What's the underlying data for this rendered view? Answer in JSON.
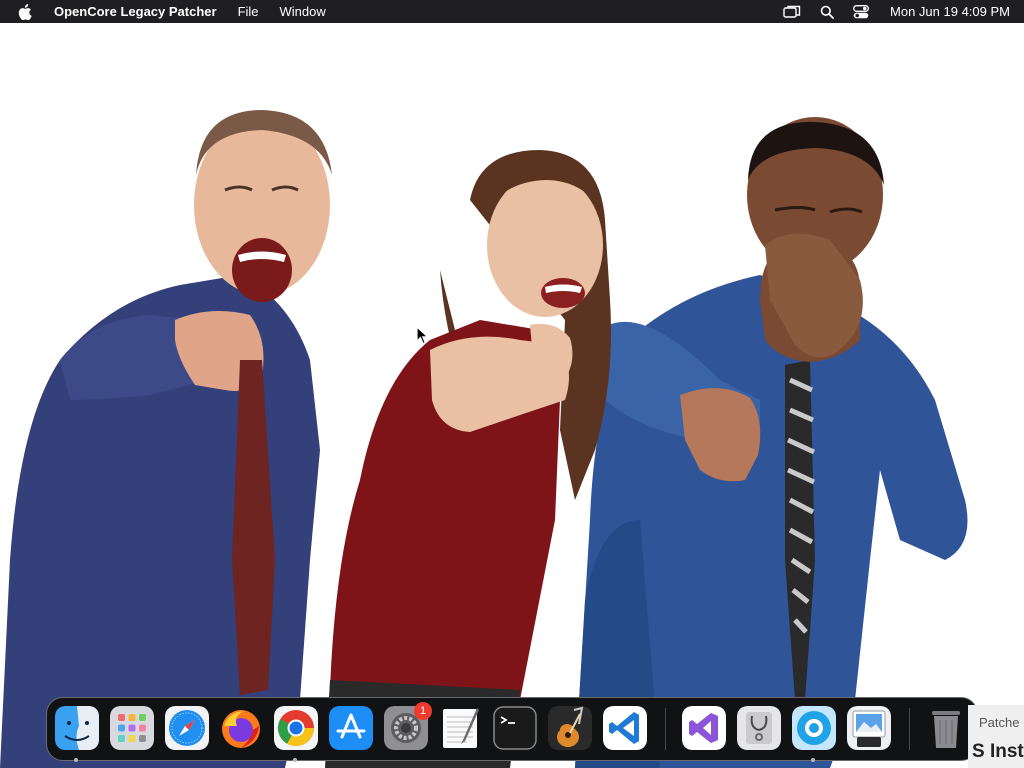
{
  "menubar": {
    "app_name": "OpenCore Legacy Patcher",
    "menus": [
      "File",
      "Window"
    ],
    "clock": "Mon Jun 19  4:09 PM",
    "background": "#1f1f21"
  },
  "wallpaper": {
    "description_icons": [
      "person-bald-man",
      "person-woman",
      "person-man-right"
    ],
    "colors": {
      "shirt_left": "#34407a",
      "dress_center": "#7e1418",
      "shirt_right": "#2f5497",
      "skin": "#e8b89a",
      "skin_dark": "#7a4a32"
    }
  },
  "dock": {
    "apps": [
      {
        "name": "Finder",
        "icon": "finder-icon",
        "running": true
      },
      {
        "name": "Launchpad",
        "icon": "launchpad-icon",
        "running": false
      },
      {
        "name": "Safari",
        "icon": "safari-icon",
        "running": false
      },
      {
        "name": "Firefox",
        "icon": "firefox-icon",
        "running": false
      },
      {
        "name": "Google Chrome",
        "icon": "chrome-icon",
        "running": true
      },
      {
        "name": "App Store",
        "icon": "app-store-icon",
        "running": false
      },
      {
        "name": "System Preferences",
        "icon": "system-preferences-icon",
        "running": false,
        "badge": "1"
      },
      {
        "name": "TextEdit",
        "icon": "textedit-icon",
        "running": false
      },
      {
        "name": "Terminal",
        "icon": "terminal-icon",
        "running": false
      },
      {
        "name": "GarageBand",
        "icon": "garageband-icon",
        "running": false
      },
      {
        "name": "Visual Studio Code",
        "icon": "vscode-icon",
        "running": false
      },
      {
        "name": "Visual Studio",
        "icon": "visual-studio-icon",
        "running": false
      },
      {
        "name": "System Information",
        "icon": "system-information-icon",
        "running": false
      },
      {
        "name": "OpenCore Legacy Patcher",
        "icon": "opencore-icon",
        "running": true
      },
      {
        "name": "Preview",
        "icon": "preview-icon",
        "running": false
      },
      {
        "name": "Trash",
        "icon": "trash-icon",
        "running": false
      }
    ],
    "badge_count": "1"
  },
  "ghost_window": {
    "line1": "Patche",
    "line2": "S Inst"
  }
}
